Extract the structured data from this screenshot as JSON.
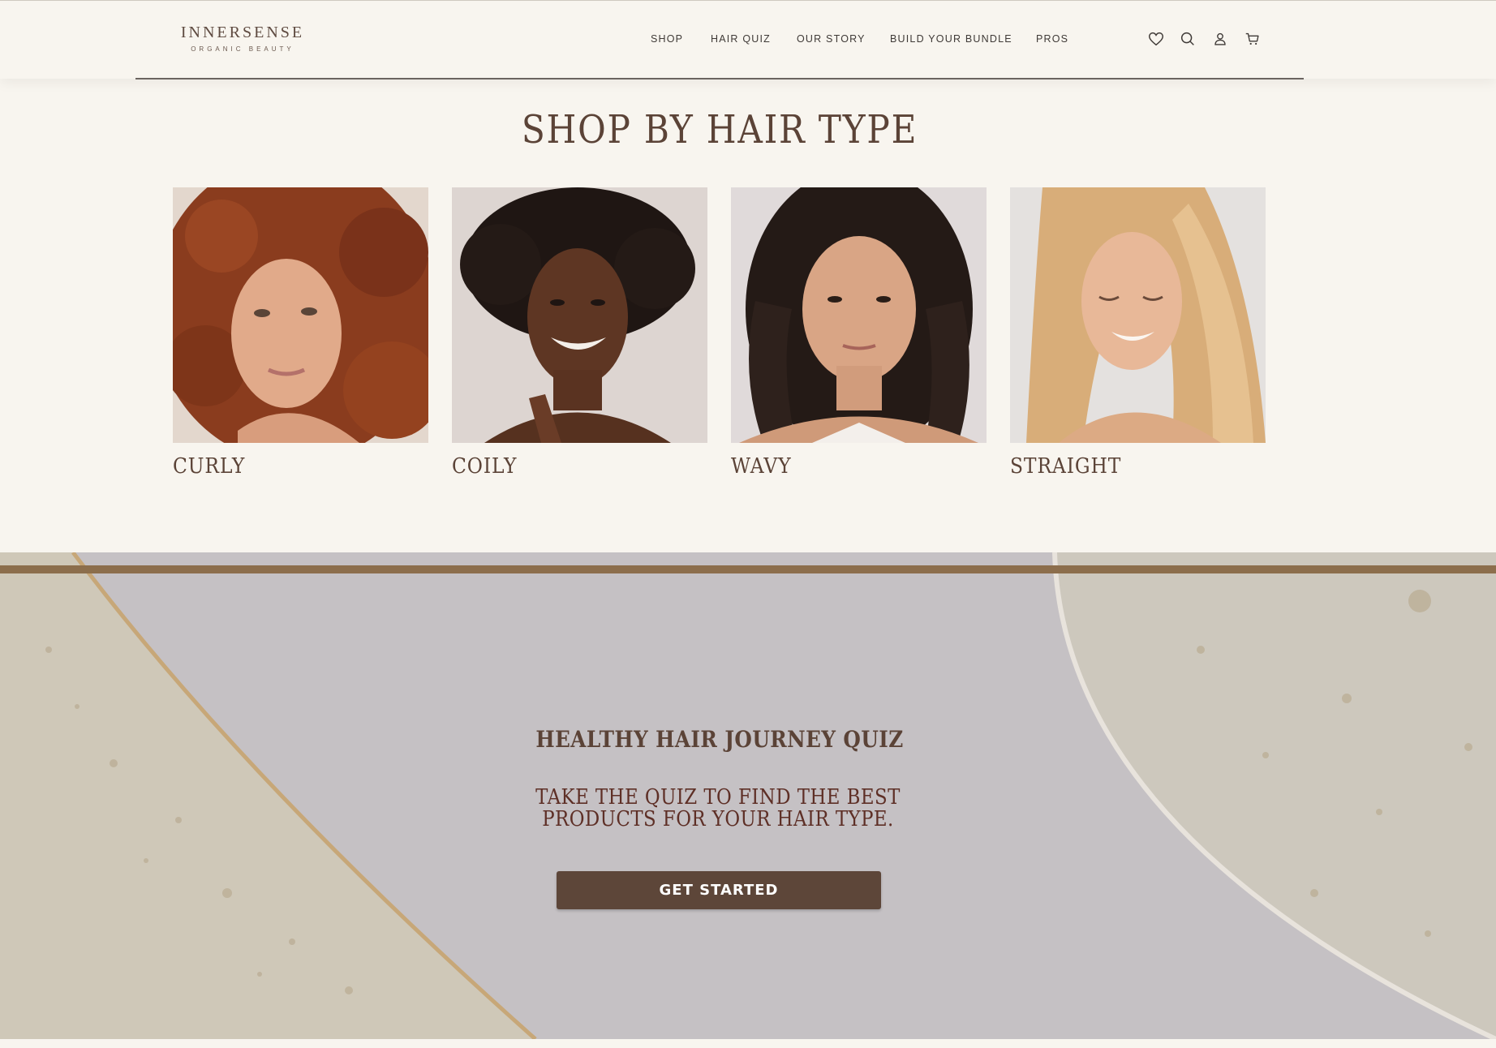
{
  "brand": {
    "name": "INNERSENSE",
    "tagline": "ORGANIC BEAUTY"
  },
  "nav": {
    "items": [
      {
        "label": "SHOP"
      },
      {
        "label": "HAIR QUIZ"
      },
      {
        "label": "OUR STORY"
      },
      {
        "label": "BUILD YOUR BUNDLE"
      },
      {
        "label": "PROS"
      }
    ]
  },
  "header_icons": [
    "heart-icon",
    "search-icon",
    "account-icon",
    "cart-icon"
  ],
  "shop_by_hair": {
    "title": "SHOP BY HAIR TYPE",
    "types": [
      {
        "label": "CURLY"
      },
      {
        "label": "COILY"
      },
      {
        "label": "WAVY"
      },
      {
        "label": "STRAIGHT"
      }
    ]
  },
  "quiz": {
    "heading": "HEALTHY HAIR JOURNEY QUIZ",
    "line1": "TAKE THE QUIZ TO FIND THE BEST",
    "line2": "PRODUCTS FOR YOUR HAIR TYPE.",
    "button": "GET STARTED"
  },
  "colors": {
    "background": "#f8f5ef",
    "text_brown": "#5b4337",
    "button": "#5d4639",
    "stripe": "#8c6e4c",
    "banner": "#c4c0c3"
  }
}
